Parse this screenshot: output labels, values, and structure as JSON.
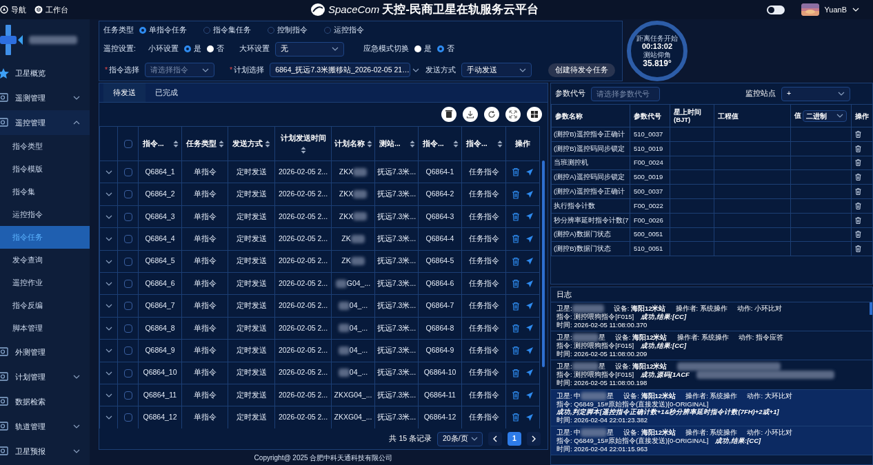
{
  "top_bar": {
    "links": [
      {
        "label": "导航"
      },
      {
        "label": "工作台"
      }
    ],
    "brand": "SpaceCom",
    "title": "天控-民商卫星在轨服务云平台",
    "toggle": {
      "on": false
    },
    "user": "YuanB"
  },
  "sidebar": {
    "items": [
      {
        "label": "卫星概览",
        "selected": false
      },
      {
        "label": "遥测管理",
        "selected": false,
        "expanded": false
      },
      {
        "label": "遥控管理",
        "selected": false,
        "expanded": true,
        "children": [
          {
            "label": "指令类型",
            "selected": false
          },
          {
            "label": "指令模版",
            "selected": false
          },
          {
            "label": "指令集",
            "selected": false
          },
          {
            "label": "运控指令",
            "selected": false
          },
          {
            "label": "指令任务",
            "selected": true
          },
          {
            "label": "发令查询",
            "selected": false
          },
          {
            "label": "遥控作业",
            "selected": false
          },
          {
            "label": "指令反编",
            "selected": false
          },
          {
            "label": "脚本管理",
            "selected": false
          }
        ]
      },
      {
        "label": "外测管理",
        "selected": false
      },
      {
        "label": "计划管理",
        "selected": false,
        "expanded": false
      },
      {
        "label": "数据检索",
        "selected": false
      },
      {
        "label": "轨道管理",
        "selected": false,
        "expanded": false
      },
      {
        "label": "卫星预报",
        "selected": false,
        "expanded": false
      }
    ]
  },
  "form": {
    "task_type": {
      "label": "任务类型",
      "options": [
        {
          "label": "单指令任务",
          "selected": true
        },
        {
          "label": "指令集任务",
          "selected": false
        },
        {
          "label": "控制指令",
          "selected": false
        },
        {
          "label": "运控指令",
          "selected": false
        }
      ]
    },
    "remote_label": "遥控设置:",
    "small_loop": {
      "label": "小环设置",
      "options": [
        {
          "label": "是",
          "selected": true
        },
        {
          "label": "否",
          "selected": false
        }
      ]
    },
    "big_loop": {
      "label": "大环设置",
      "value": "无"
    },
    "emergency": {
      "label": "应急模式切换",
      "options": [
        {
          "label": "是",
          "selected": false
        },
        {
          "label": "否",
          "selected": true
        }
      ]
    },
    "command": {
      "label": "指令选择",
      "required": true,
      "required_mark": "*",
      "placeholder": "请选择指令"
    },
    "plan": {
      "label": "计划选择",
      "required": true,
      "required_mark": "*",
      "value": "6864_抚远7.3米搬移站_2026-02-05 21…"
    },
    "send_mode": {
      "label": "发送方式",
      "value": "手动发送"
    },
    "create_button": "创建待发令任务"
  },
  "gauge": {
    "label_1": "距离任务开始",
    "value_1": "00:13:02",
    "label_2": "测站仰角",
    "value_2": "35.819°"
  },
  "tabs": [
    {
      "label": "待发送",
      "selected": true
    },
    {
      "label": "已完成",
      "selected": false
    }
  ],
  "table": {
    "all_checked": false,
    "columns": [
      {
        "label": "指令...",
        "sortable": true
      },
      {
        "label": "任务类型",
        "sortable": true
      },
      {
        "label": "发送方式",
        "sortable": true
      },
      {
        "label": "计划发送时间",
        "sortable": true
      },
      {
        "label": "计划名称",
        "sortable": true
      },
      {
        "label": "测站...",
        "sortable": true
      },
      {
        "label": "指令...",
        "sortable": true
      },
      {
        "label": "指令...",
        "sortable": true
      },
      {
        "label": "操作",
        "sortable": false
      }
    ],
    "rows": [
      {
        "checked": false,
        "cells": [
          "Q6864_1",
          "单指令",
          "定时发送",
          "2026-02-05 2...",
          "ZKX",
          "抚远7.3米...",
          "Q6864-1",
          "任务指令"
        ],
        "blur_after": true
      },
      {
        "checked": false,
        "cells": [
          "Q6864_2",
          "单指令",
          "定时发送",
          "2026-02-05 2...",
          "ZKX",
          "抚远7.3米...",
          "Q6864-2",
          "任务指令"
        ],
        "blur_after": true
      },
      {
        "checked": false,
        "cells": [
          "Q6864_3",
          "单指令",
          "定时发送",
          "2026-02-05 2...",
          "ZKX",
          "抚远7.3米...",
          "Q6864-3",
          "任务指令"
        ],
        "blur_after": true
      },
      {
        "checked": false,
        "cells": [
          "Q6864_4",
          "单指令",
          "定时发送",
          "2026-02-05 2...",
          "ZK",
          "抚远7.3米...",
          "Q6864-4",
          "任务指令"
        ],
        "blur_after": true
      },
      {
        "checked": false,
        "cells": [
          "Q6864_5",
          "单指令",
          "定时发送",
          "2026-02-05 2...",
          "ZK",
          "抚远7.3米...",
          "Q6864-5",
          "任务指令"
        ],
        "blur_after": true
      },
      {
        "checked": false,
        "cells": [
          "Q6864_6",
          "单指令",
          "定时发送",
          "2026-02-05 2...",
          "G04_...",
          "抚远7.3米...",
          "Q6864-6",
          "任务指令"
        ],
        "blur_before": true
      },
      {
        "checked": false,
        "cells": [
          "Q6864_7",
          "单指令",
          "定时发送",
          "2026-02-05 2...",
          "04_...",
          "抚远7.3米...",
          "Q6864-7",
          "任务指令"
        ],
        "blur_before": true
      },
      {
        "checked": false,
        "cells": [
          "Q6864_8",
          "单指令",
          "定时发送",
          "2026-02-05 2...",
          "04_...",
          "抚远7.3米...",
          "Q6864-8",
          "任务指令"
        ],
        "blur_before": true
      },
      {
        "checked": false,
        "cells": [
          "Q6864_9",
          "单指令",
          "定时发送",
          "2026-02-05 2...",
          "04_...",
          "抚远7.3米...",
          "Q6864-9",
          "任务指令"
        ],
        "blur_before": true
      },
      {
        "checked": false,
        "cells": [
          "Q6864_10",
          "单指令",
          "定时发送",
          "2026-02-05 2...",
          "04_...",
          "抚远7.3米...",
          "Q6864-10",
          "任务指令"
        ],
        "blur_before": true
      },
      {
        "checked": false,
        "cells": [
          "Q6864_11",
          "单指令",
          "定时发送",
          "2026-02-05 2...",
          "ZKXG04_...",
          "抚远7.3米...",
          "Q6864-11",
          "任务指令"
        ]
      },
      {
        "checked": false,
        "cells": [
          "Q6864_12",
          "单指令",
          "定时发送",
          "2026-02-05 2...",
          "ZKXG04_...",
          "抚远7.3米...",
          "Q6864-12",
          "任务指令"
        ]
      }
    ]
  },
  "pagination": {
    "total": "共 15 条记录",
    "page_size": "20条/页",
    "pages": [
      {
        "label": "1",
        "selected": true
      }
    ]
  },
  "params": {
    "code_label": "参数代号",
    "code_placeholder": "请选择参数代号",
    "station_label": "监控站点",
    "station_value": "+",
    "columns": [
      "参数名称",
      "参数代号",
      "星上时间\n(BJT)",
      "工程值",
      "值",
      "操作"
    ],
    "value_mode": "二进制",
    "rows": [
      {
        "name": "(测控B)遥控指令正确计",
        "code": "510_0037"
      },
      {
        "name": "(测控B)遥控码同步锁定",
        "code": "510_0019"
      },
      {
        "name": "当班测控机",
        "code": "F00_0024"
      },
      {
        "name": "(测控A)遥控码同步锁定",
        "code": "500_0019"
      },
      {
        "name": "(测控A)遥控指令正确计",
        "code": "500_0037"
      },
      {
        "name": "执行指令计数",
        "code": "F00_0022"
      },
      {
        "name": "秒分辨率延时指令计数(7",
        "code": "F00_0026"
      },
      {
        "name": "(测控A)数据门状态",
        "code": "500_0051"
      },
      {
        "name": "(测控B)数据门状态",
        "code": "510_0051"
      }
    ]
  },
  "log": {
    "title": "日志",
    "entries": [
      {
        "selected": false,
        "sat_label": "卫星:",
        "device": "设备: **海阳12米站**",
        "operator": "操作者: 系统操作",
        "action": "动作: 小环比对",
        "command": "指令: 测控喂狗指令[F015]",
        "result": "成功,结果:[CC]",
        "time": "时间: 2026-02-05 11:08:00.370"
      },
      {
        "selected": false,
        "sat_label": "卫星:",
        "sat_tail": "星",
        "device": "设备: **海阳12米站**",
        "operator": "操作者: 系统操作",
        "action": "动作: 指令应答",
        "command": "指令: 测控喂狗指令[F015]",
        "result": "成功,结果:[CC]",
        "time": "时间: 2026-02-05 11:08:00.209"
      },
      {
        "selected": false,
        "sat_label": "卫星:",
        "sat_tail": "星",
        "device": "设备: **海阳12米站**",
        "command": "指令: 测控喂狗指令[F015]",
        "result": "成功,源码[1ACF",
        "result_blur": true,
        "time": "时间: 2026-02-05 11:08:00.198"
      },
      {
        "selected": true,
        "sat_label": "卫星: 中",
        "sat_tail": "星",
        "device": "设备: **海阳12米站**",
        "operator": "操作者: 系统操作",
        "action": "动作: 大环比对",
        "command": "指令: Q6849_15#原始指令(直接发送)[0-ORIGINAL]",
        "result": "成功,判定脚本[遥控指令正确计数+1&秒分辨率延时指令计数(7FH)+2或+1]",
        "time": "时间: 2026-02-04 22:01:23.382"
      },
      {
        "selected": true,
        "sat_label": "卫星: 中",
        "sat_tail": "星",
        "device": "设备: **海阳12米站**",
        "operator": "操作者: 系统操作",
        "action": "动作: 小环比对",
        "command": "指令: Q6849_15#原始指令(直接发送)[0-ORIGINAL]",
        "result": "成功,结果:[CC]",
        "time": "时间: 2026-02-04 22:01:15.963"
      }
    ]
  },
  "footer": "Copyright@ 2025 合肥中科天通科技有限公司"
}
